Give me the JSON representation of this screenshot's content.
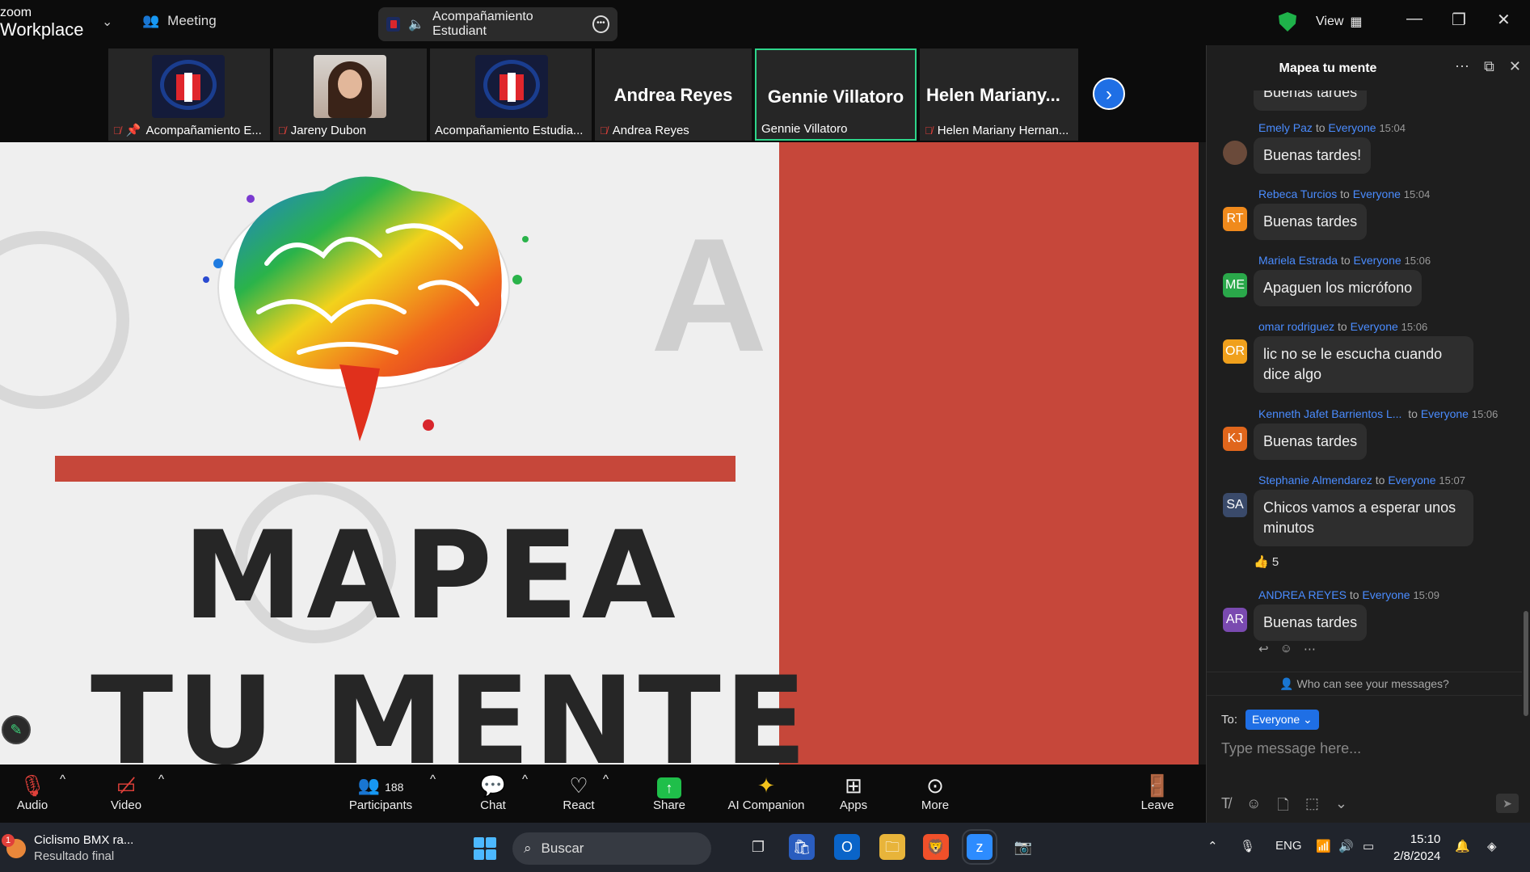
{
  "titlebar": {
    "brand_line1": "zoom",
    "brand_line2": "Workplace",
    "meeting_label": "Meeting",
    "meeting_title": "Acompañamiento Estudiant",
    "view_label": "View"
  },
  "thumbnails": [
    {
      "name": "Acompañamiento E...",
      "type": "logo",
      "muted": true,
      "pinned": true
    },
    {
      "name": "Jareny Dubon",
      "type": "photo",
      "muted": true
    },
    {
      "name": "Acompañamiento Estudia...",
      "type": "logo",
      "muted": false
    },
    {
      "name": "Andrea Reyes",
      "big": "Andrea Reyes",
      "type": "name",
      "muted": true
    },
    {
      "name": "Gennie Villatoro",
      "big": "Gennie Villatoro",
      "type": "name",
      "muted": false,
      "active": true
    },
    {
      "name": "Helen Mariany Hernan...",
      "big": "Helen  Mariany...",
      "type": "name",
      "muted": true
    }
  ],
  "slide": {
    "line1": "MAPEA",
    "line2": "TU MENTE",
    "accent_color": "#c6473a"
  },
  "toolbar": {
    "audio": "Audio",
    "video": "Video",
    "participants": "Participants",
    "participants_count": "188",
    "chat": "Chat",
    "react": "React",
    "share": "Share",
    "ai_companion": "AI Companion",
    "apps": "Apps",
    "more": "More",
    "leave": "Leave"
  },
  "chat": {
    "title": "Mapea tu mente",
    "partial_top": "Buenas tardes",
    "messages": [
      {
        "sender": "Emely Paz",
        "to": "Everyone",
        "time": "15:04",
        "initials": "",
        "color": "#6a4a3a",
        "text": "Buenas tardes!"
      },
      {
        "sender": "Rebeca Turcios",
        "to": "Everyone",
        "time": "15:04",
        "initials": "RT",
        "color": "#f08a1c",
        "text": "Buenas tardes"
      },
      {
        "sender": "Mariela Estrada",
        "to": "Everyone",
        "time": "15:06",
        "initials": "ME",
        "color": "#2aa84a",
        "text": "Apaguen los micrófono"
      },
      {
        "sender": "omar rodriguez",
        "to": "Everyone",
        "time": "15:06",
        "initials": "OR",
        "color": "#f0a01c",
        "text1": "lic no se le escucha cuando",
        "text2": "dice algo"
      },
      {
        "sender": "Kenneth Jafet Barrientos L...",
        "to": "Everyone",
        "time": "15:06",
        "initials": "KJ",
        "color": "#e0661c",
        "text": "Buenas tardes"
      },
      {
        "sender": "Stephanie Almendarez",
        "to": "Everyone",
        "time": "15:07",
        "initials": "SA",
        "color": "#3a4a6a",
        "text1": "Chicos vamos a esperar unos",
        "text2": "minutos",
        "reaction": "👍 5"
      },
      {
        "sender": "ANDREA REYES",
        "to": "Everyone",
        "time": "15:09",
        "initials": "AR",
        "color": "#7a4ab0",
        "text": "Buenas tardes"
      }
    ],
    "to_word": "to",
    "who_can_see": "Who can see your messages?",
    "to_label": "To:",
    "to_value": "Everyone",
    "placeholder": "Type message here..."
  },
  "taskbar": {
    "news_title": "Ciclismo BMX ra...",
    "news_sub": "Resultado final",
    "news_badge": "1",
    "search": "Buscar",
    "lang": "ENG",
    "time": "15:10",
    "date": "2/8/2024"
  }
}
